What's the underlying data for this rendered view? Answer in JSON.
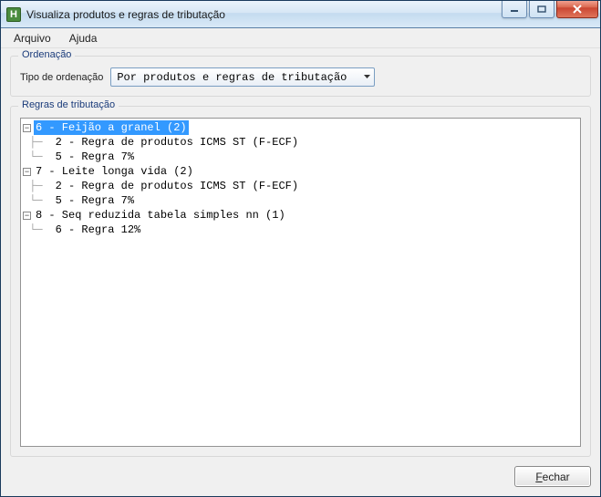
{
  "window": {
    "app_icon_letter": "H",
    "title": "Visualiza produtos e regras de tributação"
  },
  "menu": {
    "arquivo": "Arquivo",
    "ajuda": "Ajuda"
  },
  "ordenacao": {
    "group_label": "Ordenação",
    "field_label": "Tipo de ordenação",
    "selected": "Por produtos e regras de tributação"
  },
  "regras": {
    "group_label": "Regras de tributação",
    "tree": [
      {
        "label": "6 - Feijão a granel (2)",
        "expanded": true,
        "selected": true,
        "children": [
          {
            "label": "2 - Regra de produtos ICMS ST (F-ECF)"
          },
          {
            "label": "5 - Regra 7%"
          }
        ]
      },
      {
        "label": "7 - Leite longa vida (2)",
        "expanded": true,
        "children": [
          {
            "label": "2 - Regra de produtos ICMS ST (F-ECF)"
          },
          {
            "label": "5 - Regra 7%"
          }
        ]
      },
      {
        "label": "8 - Seq reduzida tabela simples nn (1)",
        "expanded": true,
        "children": [
          {
            "label": "6 - Regra 12%"
          }
        ]
      }
    ]
  },
  "footer": {
    "close_accel": "F",
    "close_rest": "echar"
  }
}
